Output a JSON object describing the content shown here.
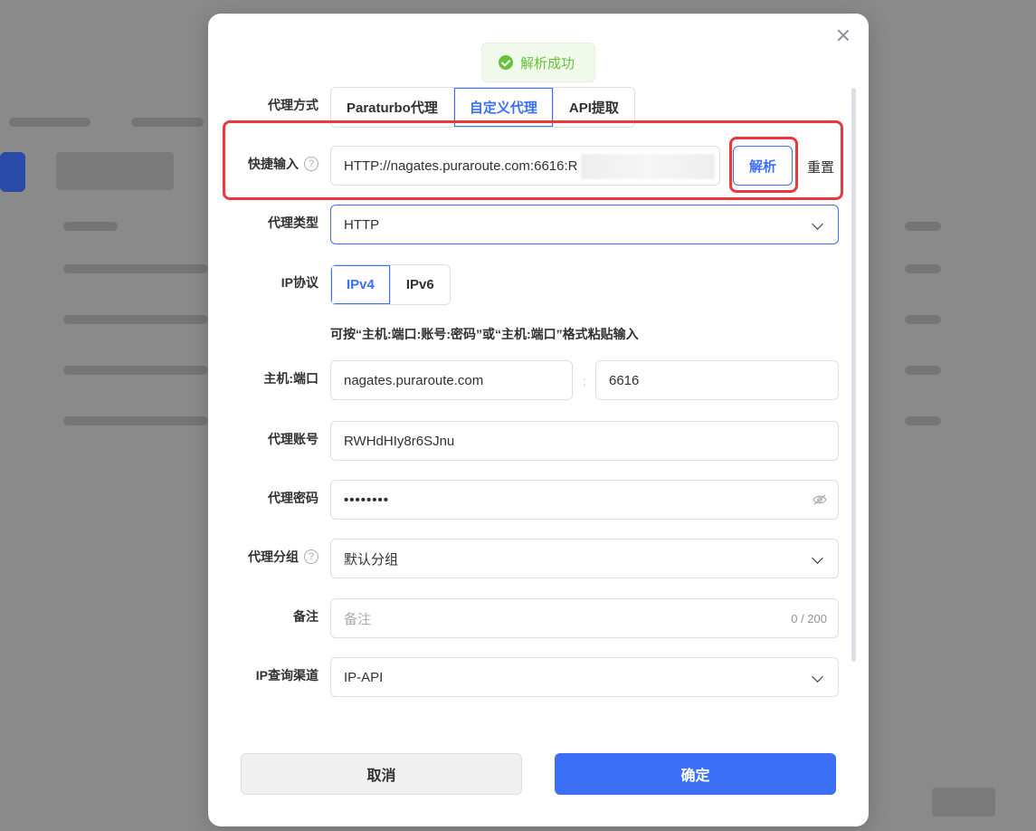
{
  "toast": {
    "message": "解析成功"
  },
  "labels": {
    "proxy_mode": "代理方式",
    "quick_input": "快捷输入",
    "proxy_type": "代理类型",
    "ip_protocol": "IP协议",
    "host_port": "主机:端口",
    "proxy_account": "代理账号",
    "proxy_password": "代理密码",
    "proxy_group": "代理分组",
    "remark": "备注",
    "ip_channel": "IP查询渠道",
    "help_glyph": "?"
  },
  "proxy_mode_tabs": [
    {
      "label": "Paraturbo代理",
      "active": false
    },
    {
      "label": "自定义代理",
      "active": true
    },
    {
      "label": "API提取",
      "active": false
    }
  ],
  "quick_input": {
    "value": "HTTP://nagates.puraroute.com:6616:R"
  },
  "buttons": {
    "parse": "解析",
    "reset": "重置",
    "cancel": "取消",
    "confirm": "确定"
  },
  "proxy_type": {
    "selected": "HTTP"
  },
  "ip_protocol_tabs": [
    {
      "label": "IPv4",
      "active": true
    },
    {
      "label": "IPv6",
      "active": false
    }
  ],
  "hint": "可按“主机:端口:账号:密码”或“主机:端口”格式粘贴输入",
  "host": {
    "value": "nagates.puraroute.com"
  },
  "port": {
    "value": "6616"
  },
  "host_port_separator": ":",
  "account": {
    "value": "RWHdHIy8r6SJnu"
  },
  "password": {
    "value": "••••••••"
  },
  "proxy_group": {
    "selected": "默认分组"
  },
  "remark": {
    "placeholder": "备注",
    "counter": "0 / 200"
  },
  "ip_channel": {
    "selected": "IP-API"
  },
  "colors": {
    "primary": "#3b6ff5",
    "success": "#67c23a",
    "highlight": "#e8393d"
  }
}
